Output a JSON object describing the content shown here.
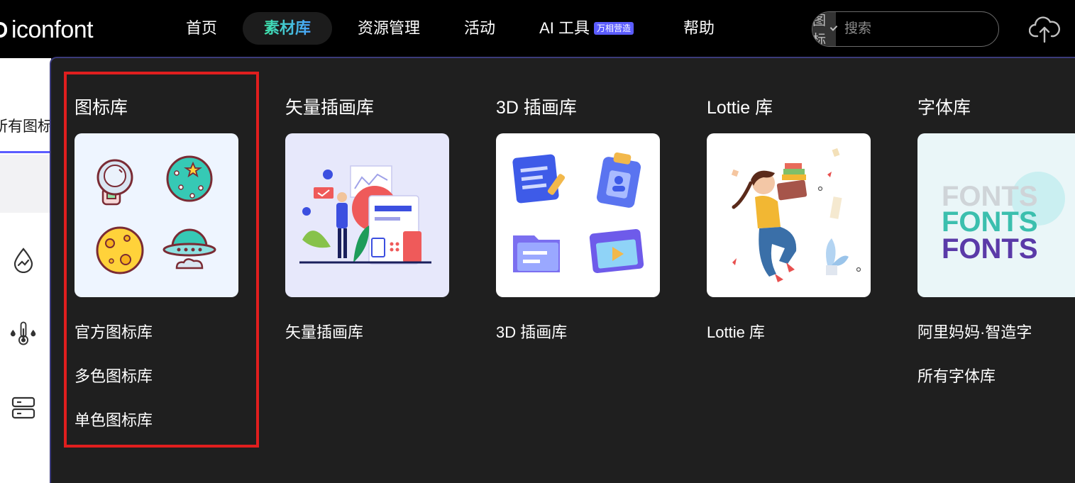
{
  "topbar": {
    "logo": "iconfont",
    "nav": [
      {
        "label": "首页"
      },
      {
        "label": "素材库"
      },
      {
        "label": "资源管理"
      },
      {
        "label": "活动"
      },
      {
        "label": "AI 工具",
        "badge": "万相营造"
      },
      {
        "label": "帮助"
      }
    ],
    "search": {
      "type_label": "图标",
      "placeholder": "搜索"
    },
    "accent_gradient": [
      "#3ee3a8",
      "#4aa3ff"
    ]
  },
  "background_page": {
    "tab_label": "所有图标"
  },
  "dropdown": {
    "columns": [
      {
        "title": "图标库",
        "links": [
          "官方图标库",
          "多色图标库",
          "单色图标库"
        ]
      },
      {
        "title": "矢量插画库",
        "links": [
          "矢量插画库"
        ]
      },
      {
        "title": "3D 插画库",
        "links": [
          "3D 插画库"
        ]
      },
      {
        "title": "Lottie 库",
        "links": [
          "Lottie 库"
        ]
      },
      {
        "title": "字体库",
        "links": [
          "阿里妈妈·智造字",
          "所有字体库"
        ]
      }
    ],
    "font_preview": [
      "FONTS",
      "FONTS",
      "FONTS"
    ],
    "highlight_color": "#e01e1e"
  }
}
